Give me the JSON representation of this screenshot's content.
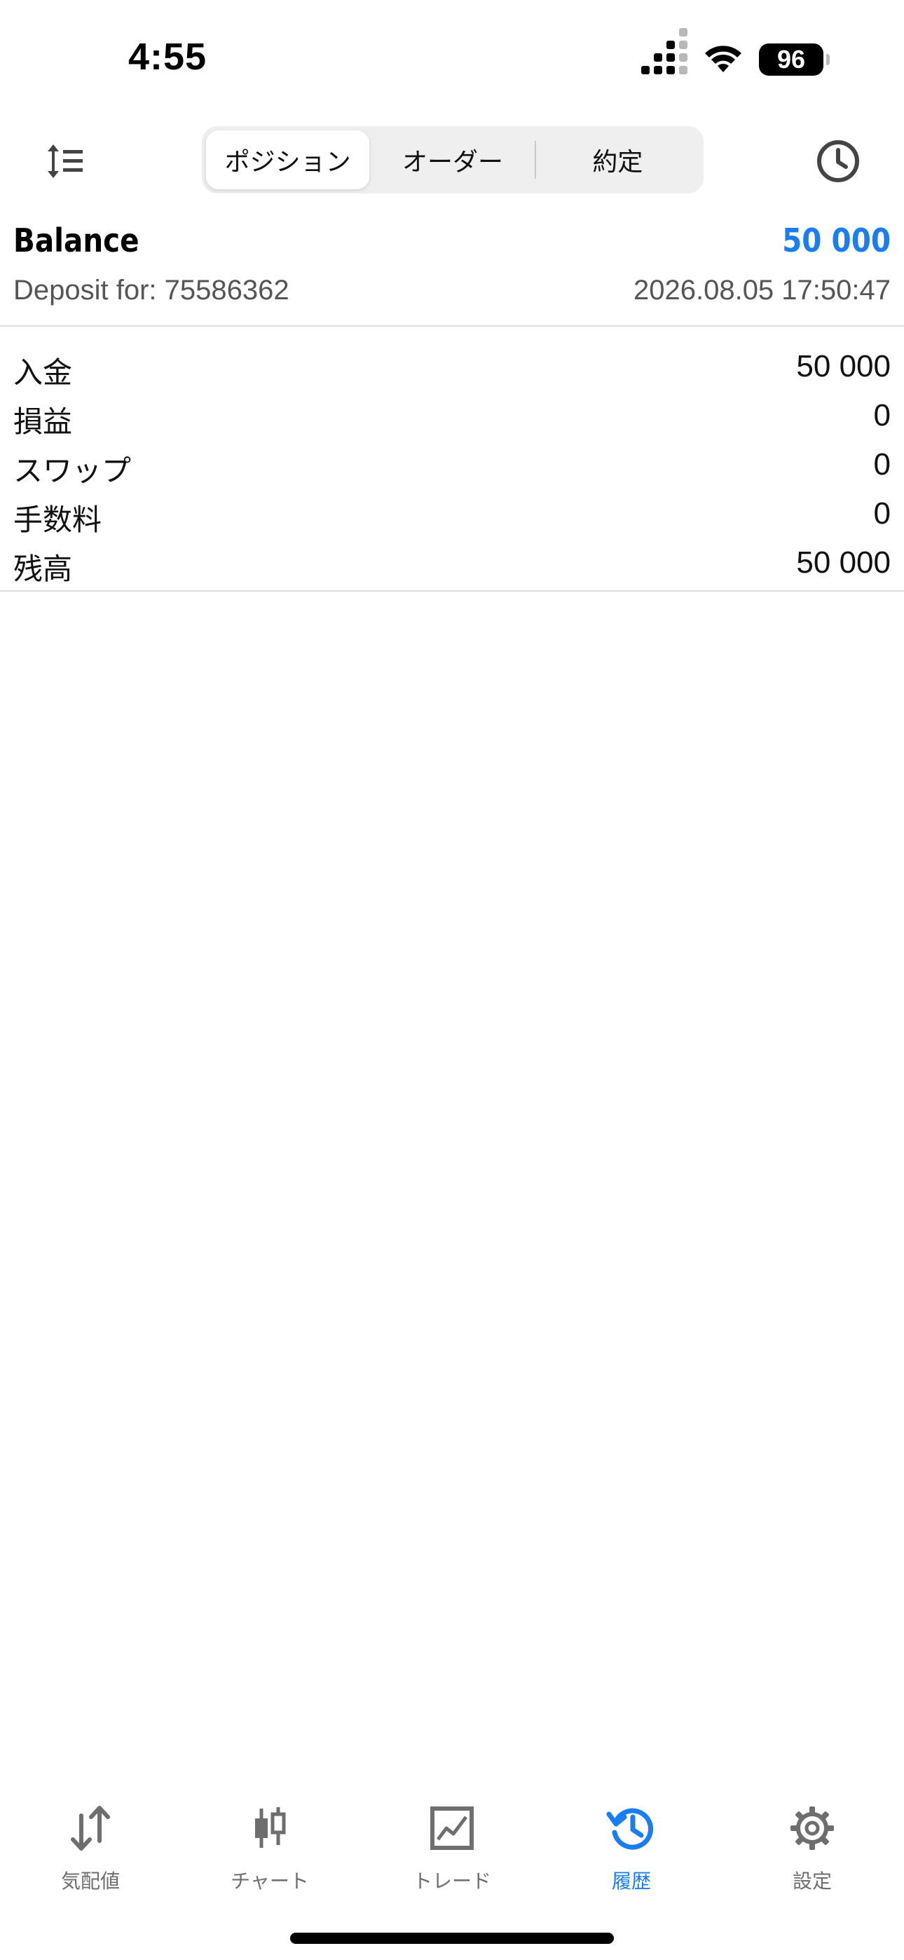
{
  "status_bar": {
    "time": "4:55",
    "battery": "96",
    "icons": [
      "cellular-signal-icon",
      "wifi-icon",
      "battery-icon"
    ]
  },
  "toolbar": {
    "sort_icon": "sort-list-icon",
    "history_icon": "clock-icon",
    "segments": [
      {
        "label": "ポジション",
        "active": true
      },
      {
        "label": "オーダー",
        "active": false
      },
      {
        "label": "約定",
        "active": false
      }
    ]
  },
  "balance": {
    "title": "Balance",
    "amount": "50 000",
    "subtitle": "Deposit for: 75586362",
    "datetime": "2026.08.05 17:50:47"
  },
  "summary": [
    {
      "label": "入金",
      "value": "50 000"
    },
    {
      "label": "損益",
      "value": "0"
    },
    {
      "label": "スワップ",
      "value": "0"
    },
    {
      "label": "手数料",
      "value": "0"
    },
    {
      "label": "残高",
      "value": "50 000"
    }
  ],
  "tabbar": [
    {
      "label": "気配値",
      "icon": "quotes-arrows-icon",
      "active": false
    },
    {
      "label": "チャート",
      "icon": "candlestick-chart-icon",
      "active": false
    },
    {
      "label": "トレード",
      "icon": "trade-chart-icon",
      "active": false
    },
    {
      "label": "履歴",
      "icon": "history-clock-icon",
      "active": true
    },
    {
      "label": "設定",
      "icon": "gear-icon",
      "active": false
    }
  ],
  "colors": {
    "accent": "#1a7ef0",
    "text": "#111111",
    "secondary_text": "#555555",
    "inactive_tab": "#6e6e6e",
    "segment_bg": "#efefef",
    "divider": "#dedede"
  }
}
